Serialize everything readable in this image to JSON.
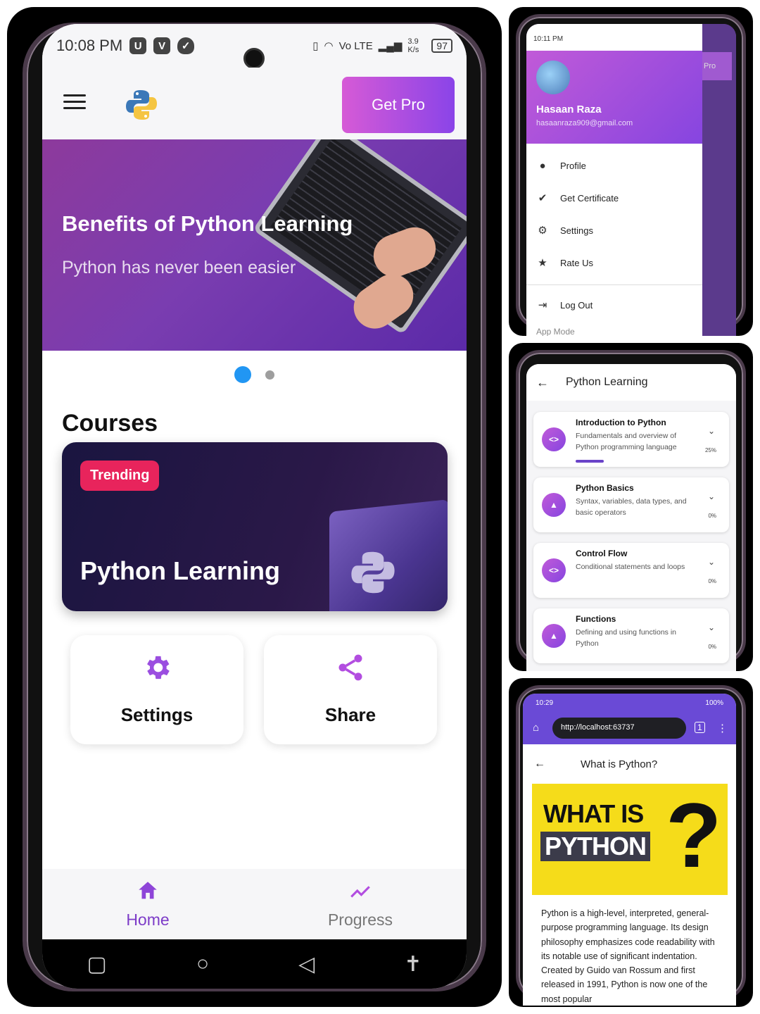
{
  "main": {
    "status": {
      "time": "10:08 PM",
      "speed": "3.9 K/s",
      "battery": "97",
      "net": "Vo LTE"
    },
    "appbar": {
      "get_pro": "Get Pro"
    },
    "banner": {
      "title": "Benefits of Python Learning",
      "subtitle": "Python has never been easier"
    },
    "courses": {
      "title": "Courses",
      "card": {
        "badge": "Trending",
        "name": "Python Learning"
      }
    },
    "tiles": {
      "settings": "Settings",
      "share": "Share"
    },
    "bottom_nav": {
      "home": "Home",
      "progress": "Progress"
    },
    "colors": {
      "accent": "#9b4ee0",
      "badge": "#e8245c",
      "dot_active": "#2196f3"
    },
    "icons": [
      "menu-icon",
      "python-logo-icon",
      "gear-icon",
      "share-icon",
      "home-icon",
      "trend-icon",
      "square-icon",
      "circle-icon",
      "triangle-back-icon",
      "accessibility-icon"
    ]
  },
  "drawer": {
    "status_time": "10:11 PM",
    "bg_pro": "Pro",
    "user": {
      "name": "Hasaan Raza",
      "email": "hasaanraza909@gmail.com"
    },
    "menu": [
      {
        "label": "Profile",
        "icon": "person-icon"
      },
      {
        "label": "Get Certificate",
        "icon": "verified-icon"
      },
      {
        "label": "Settings",
        "icon": "gear-icon"
      },
      {
        "label": "Rate Us",
        "icon": "star-icon"
      }
    ],
    "logout": "Log Out",
    "app_mode": "App Mode"
  },
  "lessons": {
    "title": "Python Learning",
    "items": [
      {
        "title": "Introduction to Python",
        "desc": "Fundamentals and overview of Python programming language",
        "pct": "25%",
        "progress": 0.25,
        "icon": "code-icon"
      },
      {
        "title": "Python Basics",
        "desc": "Syntax, variables, data types, and basic operators",
        "pct": "0%",
        "progress": 0,
        "icon": "school-icon"
      },
      {
        "title": "Control Flow",
        "desc": "Conditional statements and loops",
        "pct": "0%",
        "progress": 0,
        "icon": "code-icon"
      },
      {
        "title": "Functions",
        "desc": "Defining and using functions in Python",
        "pct": "0%",
        "progress": 0,
        "icon": "school-icon"
      }
    ]
  },
  "web": {
    "status": {
      "time": "10:29",
      "battery": "100%"
    },
    "url": "http://localhost:63737",
    "tabs_count": "1",
    "title": "What is Python?",
    "hero": {
      "line1": "WHAT IS",
      "line2": "PYTHON",
      "mark": "?"
    },
    "body": "Python is a high-level, interpreted, general-purpose programming language. Its design philosophy emphasizes code readability with its notable use of significant indentation. Created by Guido van Rossum and first released in 1991, Python is now one of the most popular"
  }
}
